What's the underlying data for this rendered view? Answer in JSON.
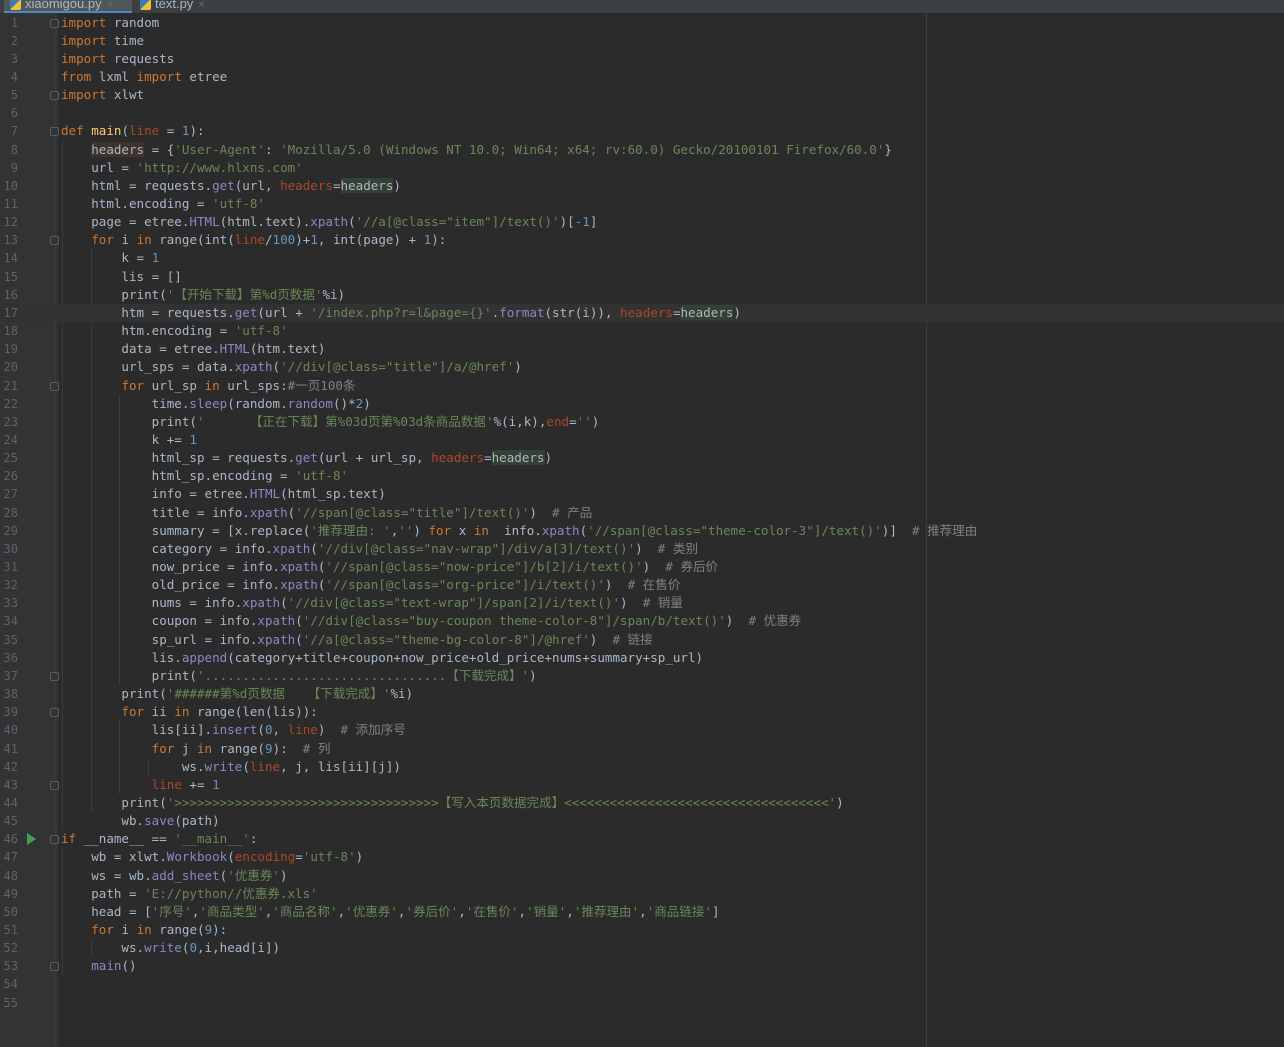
{
  "editor": {
    "tabs": [
      {
        "name": "xiaomigou.py",
        "active": true
      },
      {
        "name": "text.py",
        "active": false
      }
    ],
    "current_line": 17,
    "run_line": 46,
    "folds": [
      1,
      5,
      7,
      13,
      21,
      37,
      39,
      43,
      46,
      53
    ],
    "guides": [
      {
        "start": 8,
        "end": 45,
        "level": 1
      },
      {
        "start": 14,
        "end": 44,
        "level": 2
      },
      {
        "start": 22,
        "end": 37,
        "level": 3
      },
      {
        "start": 40,
        "end": 43,
        "level": 3
      },
      {
        "start": 42,
        "end": 42,
        "level": 4
      },
      {
        "start": 47,
        "end": 53,
        "level": 1
      },
      {
        "start": 52,
        "end": 52,
        "level": 2
      }
    ],
    "lines": [
      [
        [
          "k",
          "import"
        ],
        [
          "t",
          " random"
        ]
      ],
      [
        [
          "k",
          "import"
        ],
        [
          "t",
          " time"
        ]
      ],
      [
        [
          "k",
          "import"
        ],
        [
          "t",
          " requests"
        ]
      ],
      [
        [
          "k",
          "from"
        ],
        [
          "t",
          " lxml "
        ],
        [
          "k",
          "import"
        ],
        [
          "t",
          " etree"
        ]
      ],
      [
        [
          "k",
          "import"
        ],
        [
          "t",
          " xlwt"
        ]
      ],
      [],
      [
        [
          "k",
          "def"
        ],
        [
          "t",
          " "
        ],
        [
          "f",
          "main"
        ],
        [
          "t",
          "("
        ],
        [
          "p",
          "line"
        ],
        [
          "t",
          " = "
        ],
        [
          "n",
          "1"
        ],
        [
          "t",
          "):"
        ]
      ],
      [
        [
          "t",
          "    "
        ],
        [
          "hv",
          "headers"
        ],
        [
          "t",
          " = {"
        ],
        [
          "s",
          "'User-Agent'"
        ],
        [
          "t",
          ": "
        ],
        [
          "s",
          "'Mozilla/5.0 (Windows NT 10.0; Win64; x64; rv:60.0) Gecko/20100101 Firefox/60.0'"
        ],
        [
          "t",
          "}"
        ]
      ],
      [
        [
          "t",
          "    url = "
        ],
        [
          "s",
          "'http://www.hlxns.com'"
        ]
      ],
      [
        [
          "t",
          "    html = requests."
        ],
        [
          "b",
          "get"
        ],
        [
          "t",
          "(url, "
        ],
        [
          "p",
          "headers"
        ],
        [
          "t",
          "="
        ],
        [
          "h",
          "headers"
        ],
        [
          "t",
          ")"
        ]
      ],
      [
        [
          "t",
          "    html.encoding = "
        ],
        [
          "s",
          "'utf-8'"
        ]
      ],
      [
        [
          "t",
          "    page = etree."
        ],
        [
          "b",
          "HTML"
        ],
        [
          "t",
          "(html.text)."
        ],
        [
          "b",
          "xpath"
        ],
        [
          "t",
          "("
        ],
        [
          "s",
          "'//a[@class=\"item\"]/text()'"
        ],
        [
          "t",
          ")["
        ],
        [
          "n",
          "-1"
        ],
        [
          "t",
          "]"
        ]
      ],
      [
        [
          "t",
          "    "
        ],
        [
          "k",
          "for"
        ],
        [
          "t",
          " i "
        ],
        [
          "k",
          "in"
        ],
        [
          "t",
          " range(int("
        ],
        [
          "p",
          "line"
        ],
        [
          "t",
          "/"
        ],
        [
          "n",
          "100"
        ],
        [
          "t",
          ")+"
        ],
        [
          "n",
          "1"
        ],
        [
          "t",
          ", int(page) + "
        ],
        [
          "n",
          "1"
        ],
        [
          "t",
          "):"
        ]
      ],
      [
        [
          "t",
          "        k = "
        ],
        [
          "n",
          "1"
        ]
      ],
      [
        [
          "t",
          "        lis = []"
        ]
      ],
      [
        [
          "t",
          "        print("
        ],
        [
          "s",
          "'【开始下载】第%d页数据'"
        ],
        [
          "t",
          "%i)"
        ]
      ],
      [
        [
          "t",
          "        htm = requests."
        ],
        [
          "b",
          "get"
        ],
        [
          "t",
          "(url + "
        ],
        [
          "s",
          "'/index.php?r=l&page={}'"
        ],
        [
          "t",
          "."
        ],
        [
          "b",
          "format"
        ],
        [
          "t",
          "(str(i)), "
        ],
        [
          "p",
          "headers"
        ],
        [
          "t",
          "="
        ],
        [
          "h",
          "headers"
        ],
        [
          "t",
          ")"
        ]
      ],
      [
        [
          "t",
          "        htm.encoding = "
        ],
        [
          "s",
          "'utf-8'"
        ]
      ],
      [
        [
          "t",
          "        data = etree."
        ],
        [
          "b",
          "HTML"
        ],
        [
          "t",
          "(htm.text)"
        ]
      ],
      [
        [
          "t",
          "        url_sps = data."
        ],
        [
          "b",
          "xpath"
        ],
        [
          "t",
          "("
        ],
        [
          "s",
          "'//div[@class=\"title\"]/a/@href'"
        ],
        [
          "t",
          ")"
        ]
      ],
      [
        [
          "t",
          "        "
        ],
        [
          "k",
          "for"
        ],
        [
          "t",
          " url_sp "
        ],
        [
          "k",
          "in"
        ],
        [
          "t",
          " url_sps:"
        ],
        [
          "c",
          "#一页100条"
        ]
      ],
      [
        [
          "t",
          "            time."
        ],
        [
          "b",
          "sleep"
        ],
        [
          "t",
          "(random."
        ],
        [
          "b",
          "random"
        ],
        [
          "t",
          "()*"
        ],
        [
          "n",
          "2"
        ],
        [
          "t",
          ")"
        ]
      ],
      [
        [
          "t",
          "            print("
        ],
        [
          "s",
          "'      【正在下载】第%03d页第%03d条商品数据'"
        ],
        [
          "t",
          "%(i,k),"
        ],
        [
          "p",
          "end"
        ],
        [
          "t",
          "="
        ],
        [
          "s",
          "''"
        ],
        [
          "t",
          ")"
        ]
      ],
      [
        [
          "t",
          "            k += "
        ],
        [
          "n",
          "1"
        ]
      ],
      [
        [
          "t",
          "            html_sp = requests."
        ],
        [
          "b",
          "get"
        ],
        [
          "t",
          "(url + url_sp, "
        ],
        [
          "p",
          "headers"
        ],
        [
          "t",
          "="
        ],
        [
          "h",
          "headers"
        ],
        [
          "t",
          ")"
        ]
      ],
      [
        [
          "t",
          "            html_sp.encoding = "
        ],
        [
          "s",
          "'utf-8'"
        ]
      ],
      [
        [
          "t",
          "            info = etree."
        ],
        [
          "b",
          "HTML"
        ],
        [
          "t",
          "(html_sp.text)"
        ]
      ],
      [
        [
          "t",
          "            title = info."
        ],
        [
          "b",
          "xpath"
        ],
        [
          "t",
          "("
        ],
        [
          "s",
          "'//span[@class=\"title\"]/text()'"
        ],
        [
          "t",
          ")  "
        ],
        [
          "c",
          "# 产品"
        ]
      ],
      [
        [
          "t",
          "            summary = [x.replace("
        ],
        [
          "s",
          "'推荐理由: '"
        ],
        [
          "t",
          ","
        ],
        [
          "s",
          "''"
        ],
        [
          "t",
          ") "
        ],
        [
          "k",
          "for"
        ],
        [
          "t",
          " x "
        ],
        [
          "k",
          "in"
        ],
        [
          "t",
          "  info."
        ],
        [
          "b",
          "xpath"
        ],
        [
          "t",
          "("
        ],
        [
          "s",
          "'//span[@class=\"theme-color-3\"]/text()'"
        ],
        [
          "t",
          ")]  "
        ],
        [
          "c",
          "# 推荐理由"
        ]
      ],
      [
        [
          "t",
          "            category = info."
        ],
        [
          "b",
          "xpath"
        ],
        [
          "t",
          "("
        ],
        [
          "s",
          "'//div[@class=\"nav-wrap\"]/div/a[3]/text()'"
        ],
        [
          "t",
          ")  "
        ],
        [
          "c",
          "# 类别"
        ]
      ],
      [
        [
          "t",
          "            now_price = info."
        ],
        [
          "b",
          "xpath"
        ],
        [
          "t",
          "("
        ],
        [
          "s",
          "'//span[@class=\"now-price\"]/b[2]/i/text()'"
        ],
        [
          "t",
          ")  "
        ],
        [
          "c",
          "# 券后价"
        ]
      ],
      [
        [
          "t",
          "            old_price = info."
        ],
        [
          "b",
          "xpath"
        ],
        [
          "t",
          "("
        ],
        [
          "s",
          "'//span[@class=\"org-price\"]/i/text()'"
        ],
        [
          "t",
          ")  "
        ],
        [
          "c",
          "# 在售价"
        ]
      ],
      [
        [
          "t",
          "            nums = info."
        ],
        [
          "b",
          "xpath"
        ],
        [
          "t",
          "("
        ],
        [
          "s",
          "'//div[@class=\"text-wrap\"]/span[2]/i/text()'"
        ],
        [
          "t",
          ")  "
        ],
        [
          "c",
          "# 销量"
        ]
      ],
      [
        [
          "t",
          "            coupon = info."
        ],
        [
          "b",
          "xpath"
        ],
        [
          "t",
          "("
        ],
        [
          "s",
          "'//div[@class=\"buy-coupon theme-color-8\"]/span/b/text()'"
        ],
        [
          "t",
          ")  "
        ],
        [
          "c",
          "# 优惠券"
        ]
      ],
      [
        [
          "t",
          "            sp_url = info."
        ],
        [
          "b",
          "xpath"
        ],
        [
          "t",
          "("
        ],
        [
          "s",
          "'//a[@class=\"theme-bg-color-8\"]/@href'"
        ],
        [
          "t",
          ")  "
        ],
        [
          "c",
          "# 链接"
        ]
      ],
      [
        [
          "t",
          "            lis."
        ],
        [
          "b",
          "append"
        ],
        [
          "t",
          "(category+title+coupon+now_price+old_price+nums+summary+sp_url)"
        ]
      ],
      [
        [
          "t",
          "            print("
        ],
        [
          "s",
          "'................................【下载完成】'"
        ],
        [
          "t",
          ")"
        ]
      ],
      [
        [
          "t",
          "        print("
        ],
        [
          "s",
          "'######第%d页数据   【下载完成】'"
        ],
        [
          "t",
          "%i)"
        ]
      ],
      [
        [
          "t",
          "        "
        ],
        [
          "k",
          "for"
        ],
        [
          "t",
          " ii "
        ],
        [
          "k",
          "in"
        ],
        [
          "t",
          " range(len(lis)):"
        ]
      ],
      [
        [
          "t",
          "            lis[ii]."
        ],
        [
          "b",
          "insert"
        ],
        [
          "t",
          "("
        ],
        [
          "n",
          "0"
        ],
        [
          "t",
          ", "
        ],
        [
          "p",
          "line"
        ],
        [
          "t",
          ")  "
        ],
        [
          "c",
          "# 添加序号"
        ]
      ],
      [
        [
          "t",
          "            "
        ],
        [
          "k",
          "for"
        ],
        [
          "t",
          " j "
        ],
        [
          "k",
          "in"
        ],
        [
          "t",
          " range("
        ],
        [
          "n",
          "9"
        ],
        [
          "t",
          "):  "
        ],
        [
          "c",
          "# 列"
        ]
      ],
      [
        [
          "t",
          "                ws."
        ],
        [
          "b",
          "write"
        ],
        [
          "t",
          "("
        ],
        [
          "p",
          "line"
        ],
        [
          "t",
          ", j, lis[ii][j])"
        ]
      ],
      [
        [
          "t",
          "            "
        ],
        [
          "p",
          "line"
        ],
        [
          "t",
          " += "
        ],
        [
          "n",
          "1"
        ]
      ],
      [
        [
          "t",
          "        print("
        ],
        [
          "s",
          "'>>>>>>>>>>>>>>>>>>>>>>>>>>>>>>>>>>>【写入本页数据完成】<<<<<<<<<<<<<<<<<<<<<<<<<<<<<<<<<<<'"
        ],
        [
          "t",
          ")"
        ]
      ],
      [
        [
          "t",
          "        wb."
        ],
        [
          "b",
          "save"
        ],
        [
          "t",
          "(path)"
        ]
      ],
      [
        [
          "k",
          "if"
        ],
        [
          "t",
          " __name__ == "
        ],
        [
          "s",
          "'__main__'"
        ],
        [
          "t",
          ":"
        ]
      ],
      [
        [
          "t",
          "    wb = xlwt."
        ],
        [
          "b",
          "Workbook"
        ],
        [
          "t",
          "("
        ],
        [
          "p",
          "encoding"
        ],
        [
          "t",
          "="
        ],
        [
          "s",
          "'utf-8'"
        ],
        [
          "t",
          ")"
        ]
      ],
      [
        [
          "t",
          "    ws = wb."
        ],
        [
          "b",
          "add_sheet"
        ],
        [
          "t",
          "("
        ],
        [
          "s",
          "'优惠券'"
        ],
        [
          "t",
          ")"
        ]
      ],
      [
        [
          "t",
          "    path = "
        ],
        [
          "s",
          "'E://python//优惠券.xls'"
        ]
      ],
      [
        [
          "t",
          "    head = ["
        ],
        [
          "s",
          "'序号'"
        ],
        [
          "t",
          ","
        ],
        [
          "s",
          "'商品类型'"
        ],
        [
          "t",
          ","
        ],
        [
          "s",
          "'商品名称'"
        ],
        [
          "t",
          ","
        ],
        [
          "s",
          "'优惠券'"
        ],
        [
          "t",
          ","
        ],
        [
          "s",
          "'券后价'"
        ],
        [
          "t",
          ","
        ],
        [
          "s",
          "'在售价'"
        ],
        [
          "t",
          ","
        ],
        [
          "s",
          "'销量'"
        ],
        [
          "t",
          ","
        ],
        [
          "s",
          "'推荐理由'"
        ],
        [
          "t",
          ","
        ],
        [
          "s",
          "'商品链接'"
        ],
        [
          "t",
          "]"
        ]
      ],
      [
        [
          "t",
          "    "
        ],
        [
          "k",
          "for"
        ],
        [
          "t",
          " i "
        ],
        [
          "k",
          "in"
        ],
        [
          "t",
          " range("
        ],
        [
          "n",
          "9"
        ],
        [
          "t",
          "):"
        ]
      ],
      [
        [
          "t",
          "        ws."
        ],
        [
          "b",
          "write"
        ],
        [
          "t",
          "("
        ],
        [
          "n",
          "0"
        ],
        [
          "t",
          ",i,head[i])"
        ]
      ],
      [
        [
          "t",
          "    "
        ],
        [
          "b",
          "main"
        ],
        [
          "t",
          "()"
        ]
      ],
      [],
      []
    ]
  }
}
